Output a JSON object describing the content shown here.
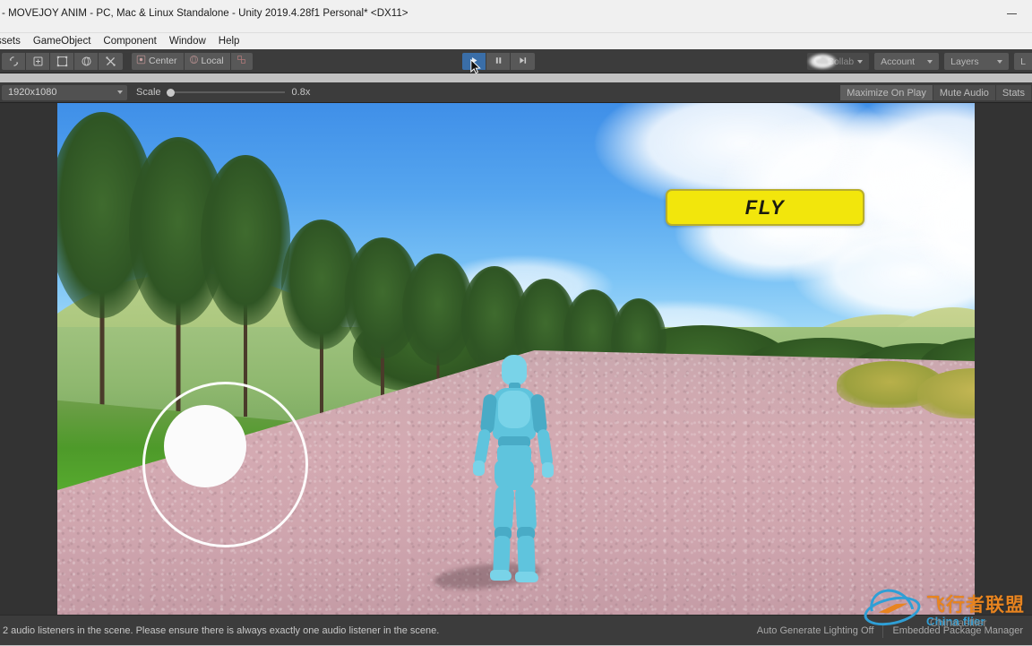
{
  "window": {
    "title": "- MOVEJOY ANIM - PC, Mac & Linux Standalone - Unity 2019.4.28f1 Personal* <DX11>",
    "minimize_label": "—"
  },
  "menubar": {
    "items": [
      {
        "label": "ssets"
      },
      {
        "label": "GameObject"
      },
      {
        "label": "Component"
      },
      {
        "label": "Window"
      },
      {
        "label": "Help"
      }
    ]
  },
  "toolbar": {
    "transform_tools": [
      {
        "name": "hand-tool",
        "icon": "hand-icon"
      },
      {
        "name": "move-tool",
        "icon": "move-icon"
      },
      {
        "name": "rotate-tool",
        "icon": "rotate-icon"
      },
      {
        "name": "scale-tool",
        "icon": "scale-icon"
      },
      {
        "name": "rect-tool",
        "icon": "rect-icon"
      },
      {
        "name": "transform-tool",
        "icon": "transform-icon"
      }
    ],
    "pivot_label": "Center",
    "handle_label": "Local",
    "play_label": "▶",
    "pause_label": "❙❙",
    "step_label": "▶❘",
    "play_active": true,
    "collab_label": "Collab",
    "cloud_label": "cloud-icon",
    "account_label": "Account",
    "layers_label": "Layers",
    "layout_label": "L"
  },
  "gametoolbar": {
    "resolution": "1920x1080",
    "scale_label": "Scale",
    "scale_value": "0.8x",
    "maximize_on_play": "Maximize On Play",
    "mute_audio": "Mute Audio",
    "stats": "Stats"
  },
  "gameview": {
    "fly_button_label": "FLY",
    "joystick_name": "virtual-joystick",
    "accent_yellow": "#f2e60c",
    "character_color": "#5fc4dd",
    "sky_color": "#56a6ef",
    "path_color": "#d4aab2",
    "grass_color": "#58ad2f"
  },
  "statusbar": {
    "message": "2 audio listeners in the scene. Please ensure there is always exactly one audio listener in the scene.",
    "lighting": "Auto Generate Lighting Off",
    "cell": "Embedded Package Manager"
  },
  "watermark": {
    "cn": "飞行者联盟",
    "en": "China flier",
    "en2": "Chinaasflier"
  }
}
